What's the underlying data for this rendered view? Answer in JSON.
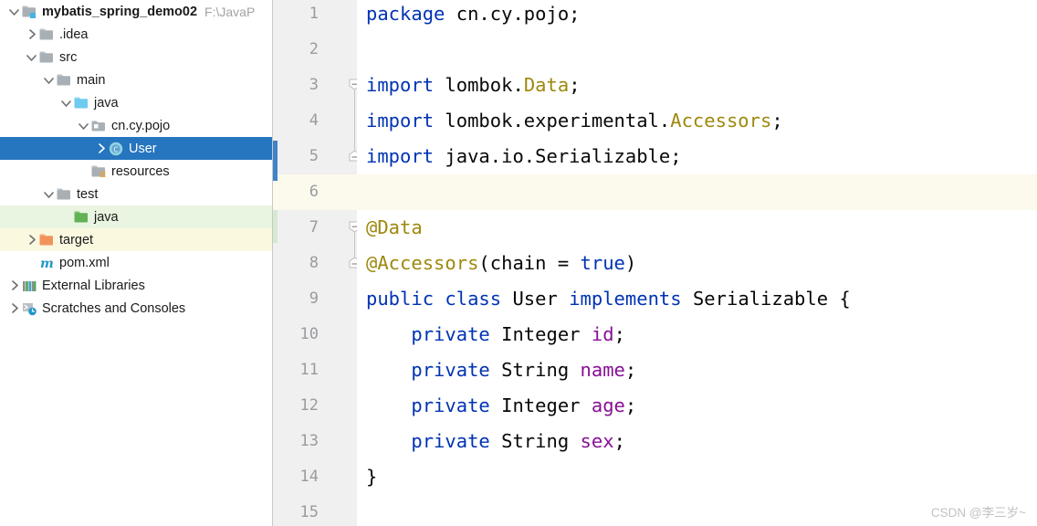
{
  "project_tree": {
    "rows": [
      {
        "label": "mybatis_spring_demo02",
        "path": "F:\\JavaP",
        "icon": "module-folder-icon",
        "arrow": "chevron-down",
        "depth": 0,
        "bold": true,
        "state": "normal"
      },
      {
        "label": ".idea",
        "path": "",
        "icon": "folder-icon",
        "arrow": "chevron-right",
        "depth": 1,
        "bold": false,
        "state": "normal"
      },
      {
        "label": "src",
        "path": "",
        "icon": "folder-icon",
        "arrow": "chevron-down",
        "depth": 1,
        "bold": false,
        "state": "normal"
      },
      {
        "label": "main",
        "path": "",
        "icon": "folder-icon",
        "arrow": "chevron-down",
        "depth": 2,
        "bold": false,
        "state": "normal"
      },
      {
        "label": "java",
        "path": "",
        "icon": "source-root-folder-icon",
        "arrow": "chevron-down",
        "depth": 3,
        "bold": false,
        "state": "normal"
      },
      {
        "label": "cn.cy.pojo",
        "path": "",
        "icon": "package-icon",
        "arrow": "chevron-down",
        "depth": 4,
        "bold": false,
        "state": "normal"
      },
      {
        "label": "User",
        "path": "",
        "icon": "java-class-icon",
        "arrow": "chevron-right",
        "depth": 5,
        "bold": false,
        "state": "selected"
      },
      {
        "label": "resources",
        "path": "",
        "icon": "resources-folder-icon",
        "arrow": "none",
        "depth": 4,
        "bold": false,
        "state": "normal"
      },
      {
        "label": "test",
        "path": "",
        "icon": "folder-icon",
        "arrow": "chevron-down",
        "depth": 2,
        "bold": false,
        "state": "normal"
      },
      {
        "label": "java",
        "path": "",
        "icon": "test-source-root-folder-icon",
        "arrow": "none",
        "depth": 3,
        "bold": false,
        "state": "tint-green"
      },
      {
        "label": "target",
        "path": "",
        "icon": "excluded-folder-icon",
        "arrow": "chevron-right",
        "depth": 1,
        "bold": false,
        "state": "tint-yellow"
      },
      {
        "label": "pom.xml",
        "path": "",
        "icon": "maven-icon",
        "arrow": "none",
        "depth": 1,
        "bold": false,
        "state": "normal"
      },
      {
        "label": "External Libraries",
        "path": "",
        "icon": "library-icon",
        "arrow": "chevron-right",
        "depth": 0,
        "bold": false,
        "state": "normal"
      },
      {
        "label": "Scratches and Consoles",
        "path": "",
        "icon": "scratches-icon",
        "arrow": "chevron-right",
        "depth": 0,
        "bold": false,
        "state": "normal"
      }
    ]
  },
  "editor": {
    "caret_line": 6,
    "line_numbers": [
      "1",
      "2",
      "3",
      "4",
      "5",
      "6",
      "7",
      "8",
      "9",
      "10",
      "11",
      "12",
      "13",
      "14",
      "15"
    ],
    "lines": [
      {
        "num": "1",
        "tokens": [
          {
            "t": "package",
            "c": "kw"
          },
          {
            "t": " cn.cy.pojo;",
            "c": "pln"
          }
        ]
      },
      {
        "num": "2",
        "tokens": []
      },
      {
        "num": "3",
        "tokens": [
          {
            "t": "import",
            "c": "kw"
          },
          {
            "t": " lombok.",
            "c": "pln"
          },
          {
            "t": "Data",
            "c": "ann"
          },
          {
            "t": ";",
            "c": "pln"
          }
        ]
      },
      {
        "num": "4",
        "tokens": [
          {
            "t": "import",
            "c": "kw"
          },
          {
            "t": " lombok.experimental.",
            "c": "pln"
          },
          {
            "t": "Accessors",
            "c": "ann"
          },
          {
            "t": ";",
            "c": "pln"
          }
        ]
      },
      {
        "num": "5",
        "tokens": [
          {
            "t": "import",
            "c": "kw"
          },
          {
            "t": " java.io.Serializable;",
            "c": "pln"
          }
        ]
      },
      {
        "num": "6",
        "tokens": []
      },
      {
        "num": "7",
        "tokens": [
          {
            "t": "@Data",
            "c": "ann"
          }
        ]
      },
      {
        "num": "8",
        "tokens": [
          {
            "t": "@Accessors",
            "c": "ann"
          },
          {
            "t": "(chain = ",
            "c": "pln"
          },
          {
            "t": "true",
            "c": "kw"
          },
          {
            "t": ")",
            "c": "pln"
          }
        ]
      },
      {
        "num": "9",
        "tokens": [
          {
            "t": "public",
            "c": "kw"
          },
          {
            "t": " ",
            "c": "pln"
          },
          {
            "t": "class",
            "c": "kw"
          },
          {
            "t": " User ",
            "c": "pln"
          },
          {
            "t": "implements",
            "c": "kw"
          },
          {
            "t": " Serializable {",
            "c": "pln"
          }
        ]
      },
      {
        "num": "10",
        "tokens": [
          {
            "t": "    ",
            "c": "pln"
          },
          {
            "t": "private",
            "c": "kw"
          },
          {
            "t": " Integer ",
            "c": "pln"
          },
          {
            "t": "id",
            "c": "fld"
          },
          {
            "t": ";",
            "c": "pln"
          }
        ]
      },
      {
        "num": "11",
        "tokens": [
          {
            "t": "    ",
            "c": "pln"
          },
          {
            "t": "private",
            "c": "kw"
          },
          {
            "t": " String ",
            "c": "pln"
          },
          {
            "t": "name",
            "c": "fld"
          },
          {
            "t": ";",
            "c": "pln"
          }
        ]
      },
      {
        "num": "12",
        "tokens": [
          {
            "t": "    ",
            "c": "pln"
          },
          {
            "t": "private",
            "c": "kw"
          },
          {
            "t": " Integer ",
            "c": "pln"
          },
          {
            "t": "age",
            "c": "fld"
          },
          {
            "t": ";",
            "c": "pln"
          }
        ]
      },
      {
        "num": "13",
        "tokens": [
          {
            "t": "    ",
            "c": "pln"
          },
          {
            "t": "private",
            "c": "kw"
          },
          {
            "t": " String ",
            "c": "pln"
          },
          {
            "t": "sex",
            "c": "fld"
          },
          {
            "t": ";",
            "c": "pln"
          }
        ]
      },
      {
        "num": "14",
        "tokens": [
          {
            "t": "}",
            "c": "pln"
          }
        ]
      },
      {
        "num": "15",
        "tokens": []
      }
    ],
    "fold_markers": [
      {
        "line": 3,
        "type": "fold-start"
      },
      {
        "line": 5,
        "type": "fold-end"
      },
      {
        "line": 7,
        "type": "fold-start"
      },
      {
        "line": 8,
        "type": "fold-end"
      }
    ]
  },
  "watermark": {
    "text": "CSDN @李三岁~"
  },
  "colors": {
    "selection_blue": "#2675bf",
    "keyword": "#0033b3",
    "annotation": "#9e880d",
    "field": "#871094",
    "caret_row": "#fcf9ed",
    "gutter_bg": "#f0f0f0",
    "test_root_tint": "#e9f5e0",
    "excluded_tint": "#fbf8e0"
  }
}
